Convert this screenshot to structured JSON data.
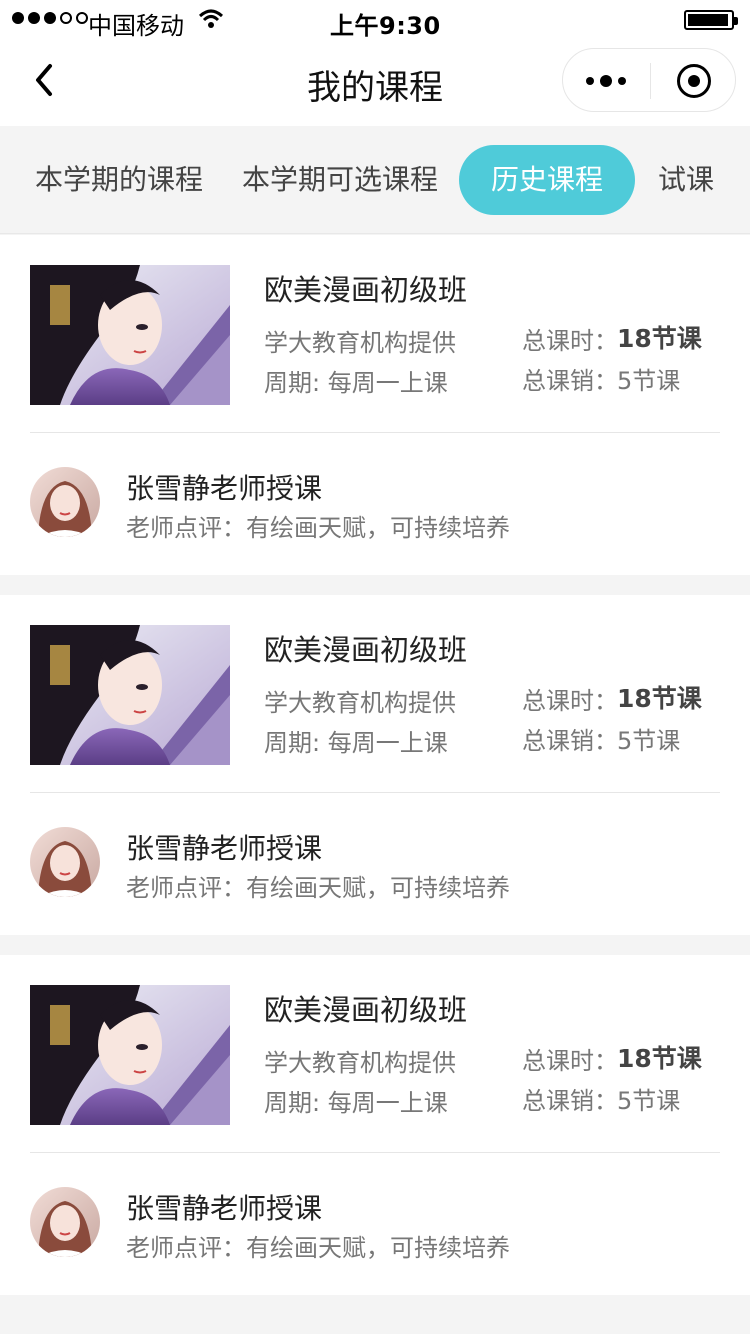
{
  "status_bar": {
    "carrier": "中国移动",
    "time": "上午9:30"
  },
  "nav": {
    "title": "我的课程"
  },
  "tabs": [
    {
      "label": "本学期的课程",
      "active": false
    },
    {
      "label": "本学期可选课程",
      "active": false
    },
    {
      "label": "历史课程",
      "active": true
    },
    {
      "label": "试课",
      "active": false
    }
  ],
  "colors": {
    "accent": "#4fcbd9",
    "background": "#f4f4f4"
  },
  "courses": [
    {
      "title": "欧美漫画初级班",
      "provider": "学大教育机构提供",
      "period": "周期: 每周一上课",
      "total_label": "总课时：",
      "total_value": "18节课",
      "sold_label": "总课销：",
      "sold_value": "5节课",
      "teacher": "张雪静老师授课",
      "review": "老师点评：有绘画天赋，可持续培养"
    },
    {
      "title": "欧美漫画初级班",
      "provider": "学大教育机构提供",
      "period": "周期: 每周一上课",
      "total_label": "总课时：",
      "total_value": "18节课",
      "sold_label": "总课销：",
      "sold_value": "5节课",
      "teacher": "张雪静老师授课",
      "review": "老师点评：有绘画天赋，可持续培养"
    },
    {
      "title": "欧美漫画初级班",
      "provider": "学大教育机构提供",
      "period": "周期: 每周一上课",
      "total_label": "总课时：",
      "total_value": "18节课",
      "sold_label": "总课销：",
      "sold_value": "5节课",
      "teacher": "张雪静老师授课",
      "review": "老师点评：有绘画天赋，可持续培养"
    }
  ]
}
